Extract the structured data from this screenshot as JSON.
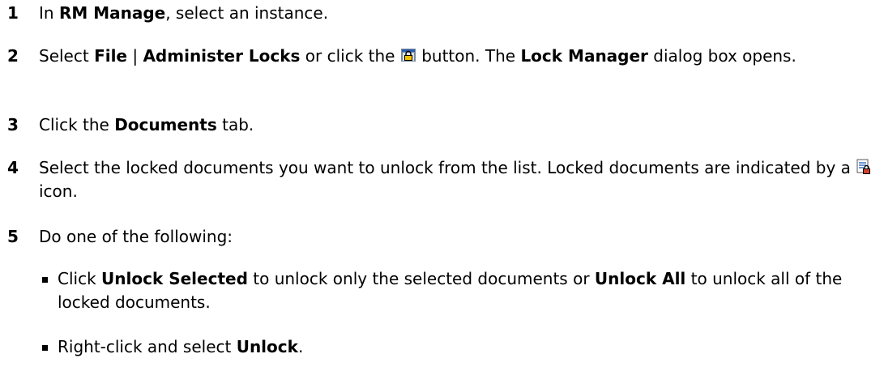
{
  "steps": [
    {
      "num": "1",
      "t1": "In ",
      "b1": "RM Manage",
      "t2": ", select an instance."
    },
    {
      "num": "2",
      "t1": "Select ",
      "b1": "File",
      "t2": " | ",
      "b2": "Administer Locks",
      "t3": " or click the ",
      "t4": " button. The ",
      "b3": "Lock Manager",
      "t5": " dialog box opens."
    },
    {
      "num": "3",
      "t1": "Click the ",
      "b1": "Documents",
      "t2": " tab."
    },
    {
      "num": "4",
      "t1": "Select the locked documents you want to unlock from the list. Locked documents are indicated by a ",
      "t2": " icon."
    },
    {
      "num": "5",
      "t1": "Do one of the following:"
    }
  ],
  "bullets": [
    {
      "t1": "Click ",
      "b1": "Unlock Selected",
      "t2": " to unlock only the selected documents or ",
      "b2": "Unlock All",
      "t3": " to unlock all of the locked documents."
    },
    {
      "t1": "Right-click and select ",
      "b1": "Unlock",
      "t2": "."
    }
  ],
  "icons": {
    "administer_locks": "lock-manager-icon",
    "locked_document": "locked-document-icon"
  }
}
